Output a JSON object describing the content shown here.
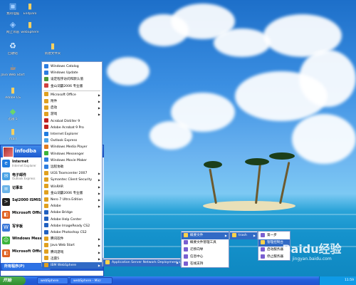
{
  "desktop_icons": [
    {
      "name": "my-computer-icon",
      "glyph": "▣",
      "label": "我的电脑",
      "color": "#9ecbff"
    },
    {
      "name": "network-icon",
      "glyph": "◈",
      "label": "网上邻居",
      "color": "#9ecbff"
    },
    {
      "name": "recycle-bin-icon",
      "glyph": "♻",
      "label": "回收站",
      "color": "#e0f0ff"
    },
    {
      "name": "java-icon",
      "glyph": "☕",
      "label": "Java Web Start",
      "color": "#ff9a3c"
    },
    {
      "name": "folder-icon",
      "glyph": "▮",
      "label": "Adobe CS",
      "color": "#f5d060"
    },
    {
      "name": "app-icon",
      "glyph": "◆",
      "label": "迅雷 5",
      "color": "#6bd66b"
    },
    {
      "name": "folder-icon-2",
      "glyph": "▮",
      "label": "mail",
      "color": "#f5d060"
    }
  ],
  "desktop_icons_top": [
    {
      "name": "folder-icon-top-1",
      "glyph": "▮",
      "label": "Endparo",
      "color": "#f5d060"
    },
    {
      "name": "folder-icon-top-2",
      "glyph": "▮",
      "label": "webSphere",
      "color": "#f5d060"
    },
    {
      "name": "folder-icon-top-3",
      "glyph": "▮",
      "label": "新建文件夹",
      "color": "#f5d060"
    }
  ],
  "start_menu": {
    "user": "infodba",
    "pinned": [
      {
        "name": "internet-explorer-icon",
        "title": "Internet",
        "sub": "Internet Explorer",
        "color": "#1f7be0",
        "glyph": "e"
      },
      {
        "name": "email-icon",
        "title": "电子邮件",
        "sub": "Outlook Express",
        "color": "#4aa3e6",
        "glyph": "✉"
      },
      {
        "name": "notepad-icon",
        "title": "记事本",
        "sub": "",
        "color": "#6cb3e8",
        "glyph": "≡"
      },
      {
        "name": "cmd-icon",
        "title": "Sql2000 ISMISM Prompt",
        "sub": "",
        "color": "#222",
        "glyph": ">"
      },
      {
        "name": "office-icon",
        "title": "Microsoft Office 2007",
        "sub": "",
        "color": "#e06020",
        "glyph": "◧"
      },
      {
        "name": "wordpad-icon",
        "title": "写字板",
        "sub": "",
        "color": "#3a78d8",
        "glyph": "W"
      },
      {
        "name": "messenger-icon",
        "title": "Windows Messenger",
        "sub": "",
        "color": "#3bb43b",
        "glyph": "☺"
      },
      {
        "name": "office-icon-2",
        "title": "Microsoft Office 2007",
        "sub": "",
        "color": "#e06020",
        "glyph": "◧"
      }
    ],
    "all_programs": "所有程序(P)",
    "shutdown": "关闭计算机(U)"
  },
  "programs": [
    {
      "label": "Windows Catalog",
      "color": "#2d7de0",
      "arrow": false
    },
    {
      "label": "Windows Update",
      "color": "#2d7de0",
      "arrow": false
    },
    {
      "label": "设定程序访问和默认值",
      "color": "#4a9a3a",
      "arrow": false
    },
    {
      "label": "金山词霸2006 专业版",
      "color": "#d04040",
      "arrow": false
    },
    {
      "sep": true
    },
    {
      "label": "Microsoft Office",
      "color": "#e0a020",
      "arrow": true
    },
    {
      "label": "附件",
      "color": "#e0a020",
      "arrow": true
    },
    {
      "label": "启动",
      "color": "#e0a020",
      "arrow": true
    },
    {
      "label": "游戏",
      "color": "#e0a020",
      "arrow": true
    },
    {
      "label": "Acrobat Distiller 9",
      "color": "#c02020",
      "arrow": false
    },
    {
      "label": "Adobe Acrobat 9 Pro",
      "color": "#c02020",
      "arrow": false
    },
    {
      "label": "Internet Explorer",
      "color": "#1f7be0",
      "arrow": false
    },
    {
      "label": "Outlook Express",
      "color": "#4aa3e6",
      "arrow": false
    },
    {
      "label": "Windows Media Player",
      "color": "#e07a20",
      "arrow": false
    },
    {
      "label": "Windows Messenger",
      "color": "#3bb43b",
      "arrow": false
    },
    {
      "label": "Windows Movie Maker",
      "color": "#2d7de0",
      "arrow": false
    },
    {
      "label": "远程协助",
      "color": "#2d7de0",
      "arrow": false
    },
    {
      "label": "UGS Teamcenter 2007",
      "color": "#e0a020",
      "arrow": true
    },
    {
      "label": "Symantec Client Security",
      "color": "#e0a020",
      "arrow": true
    },
    {
      "label": "WinRAR",
      "color": "#e0a020",
      "arrow": true
    },
    {
      "label": "金山词霸2006 专业版",
      "color": "#e0a020",
      "arrow": true
    },
    {
      "label": "Nero 7 Ultra Edition",
      "color": "#e0a020",
      "arrow": true
    },
    {
      "label": "Adobe",
      "color": "#e0a020",
      "arrow": true
    },
    {
      "label": "Adobe Bridge",
      "color": "#2060c0",
      "arrow": false
    },
    {
      "label": "Adobe Help Center",
      "color": "#2060c0",
      "arrow": false
    },
    {
      "label": "Adobe ImageReady CS2",
      "color": "#2060c0",
      "arrow": false
    },
    {
      "label": "Adobe Photoshop CS2",
      "color": "#2060c0",
      "arrow": false
    },
    {
      "label": "腾讯软件",
      "color": "#e0a020",
      "arrow": true
    },
    {
      "label": "Java Web Start",
      "color": "#e0a020",
      "arrow": true
    },
    {
      "label": "腾讯游戏",
      "color": "#e0a020",
      "arrow": true
    },
    {
      "label": "迅雷5",
      "color": "#e0a020",
      "arrow": true
    },
    {
      "label": "IBM WebSphere",
      "color": "#e0a020",
      "arrow": true,
      "hl": true
    }
  ],
  "submenu_websphere": [
    {
      "label": "Application Server Network Deployment V6.1",
      "arrow": true,
      "hl": true
    }
  ],
  "submenu_profiles": [
    {
      "label": "概要文件",
      "arrow": true,
      "hl": true
    },
    {
      "label": "概要文件管理工具",
      "arrow": false
    },
    {
      "label": "迁移向导",
      "arrow": false
    },
    {
      "label": "信息中心",
      "arrow": false
    },
    {
      "label": "在线支持",
      "arrow": false
    }
  ],
  "submenu_profile_name": [
    {
      "label": "trash",
      "arrow": true,
      "hl": true
    }
  ],
  "submenu_actions": [
    {
      "label": "第一步",
      "arrow": false
    },
    {
      "label": "管理控制台",
      "arrow": false,
      "hl": true
    },
    {
      "label": "启动服务器",
      "arrow": false
    },
    {
      "label": "停止服务器",
      "arrow": false
    }
  ],
  "taskbar": {
    "start": "开始",
    "items": [
      "webSphere",
      "webSphere - Micr"
    ],
    "clock": "11:59"
  },
  "watermark": {
    "logo": "Baidu经验",
    "url": "jingyan.baidu.com"
  }
}
